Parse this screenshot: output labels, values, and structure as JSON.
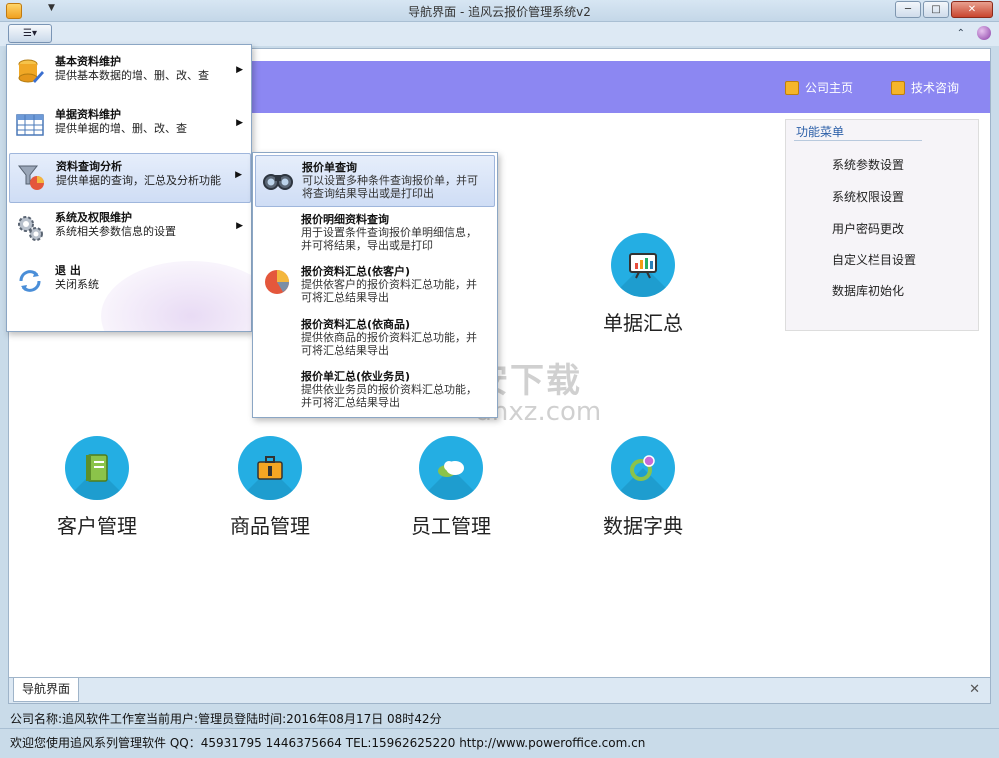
{
  "window": {
    "title": "导航界面 - 追风云报价管理系统v2",
    "minimize": "─",
    "maximize": "□",
    "close": "✕"
  },
  "ribbon": {
    "menu_button": "☰▾",
    "collapse": "⌃"
  },
  "header": {
    "links": [
      {
        "label": "公司主页",
        "icon": "home-page-icon"
      },
      {
        "label": "技术咨询",
        "icon": "consult-icon"
      }
    ]
  },
  "func_menu": {
    "title": "功能菜单",
    "items": [
      "系统参数设置",
      "系统权限设置",
      "用户密码更改",
      "自定义栏目设置",
      "数据库初始化"
    ]
  },
  "modules": [
    {
      "label": "单据汇总",
      "icon": "chart-board-icon"
    },
    {
      "label": "客户管理",
      "icon": "notebook-icon"
    },
    {
      "label": "商品管理",
      "icon": "briefcase-icon"
    },
    {
      "label": "员工管理",
      "icon": "cloud-icon"
    },
    {
      "label": "数据字典",
      "icon": "dictionary-icon"
    }
  ],
  "dropdown": {
    "items": [
      {
        "title": "基本资料维护",
        "desc": "提供基本数据的增、删、改、查",
        "arrow": "▶",
        "icon": "database-icon"
      },
      {
        "title": "单据资料维护",
        "desc": "提供单据的增、删、改、查",
        "arrow": "▶",
        "icon": "table-icon"
      },
      {
        "title": "资料查询分析",
        "desc": "提供单据的查询，汇总及分析功能",
        "arrow": "▶",
        "icon": "query-analysis-icon"
      },
      {
        "title": "系统及权限维护",
        "desc": "系统相关参数信息的设置",
        "arrow": "▶",
        "icon": "gears-icon"
      },
      {
        "title": "退 出",
        "desc": "关闭系统",
        "arrow": "",
        "icon": "exit-icon"
      }
    ]
  },
  "submenu": {
    "items": [
      {
        "title": "报价单查询",
        "desc": "可以设置多种条件查询报价单，并可将查询结果导出或是打印出",
        "icon": "binoculars-icon"
      },
      {
        "title": "报价明细资料查询",
        "desc": "用于设置条件查询报价单明细信息，并可将结果，导出或是打印",
        "icon": ""
      },
      {
        "title": "报价资料汇总(依客户)",
        "desc": "提供依客户的报价资料汇总功能，并可将汇总结果导出",
        "icon": "pie-chart-icon"
      },
      {
        "title": "报价资料汇总(依商品)",
        "desc": "提供依商品的报价资料汇总功能，并可将汇总结果导出",
        "icon": ""
      },
      {
        "title": "报价单汇总(依业务员)",
        "desc": "提供依业务员的报价资料汇总功能，并可将汇总结果导出",
        "icon": ""
      }
    ]
  },
  "watermark": {
    "cn": "安下载",
    "en": "anxz.com"
  },
  "tabs": [
    {
      "label": "导航界面"
    }
  ],
  "tab_close": "✕",
  "status": {
    "line1": "公司名称:追风软件工作室当前用户:管理员登陆时间:2016年08月17日 08时42分",
    "line2": "欢迎您使用追风系列管理软件 QQ：45931795 1446375664 TEL:15962625220 http://www.poweroffice.com.cn"
  },
  "colors": {
    "header_band": "#8c87f2",
    "module_circle": "#24aee3",
    "link_text": "#ffffff"
  }
}
